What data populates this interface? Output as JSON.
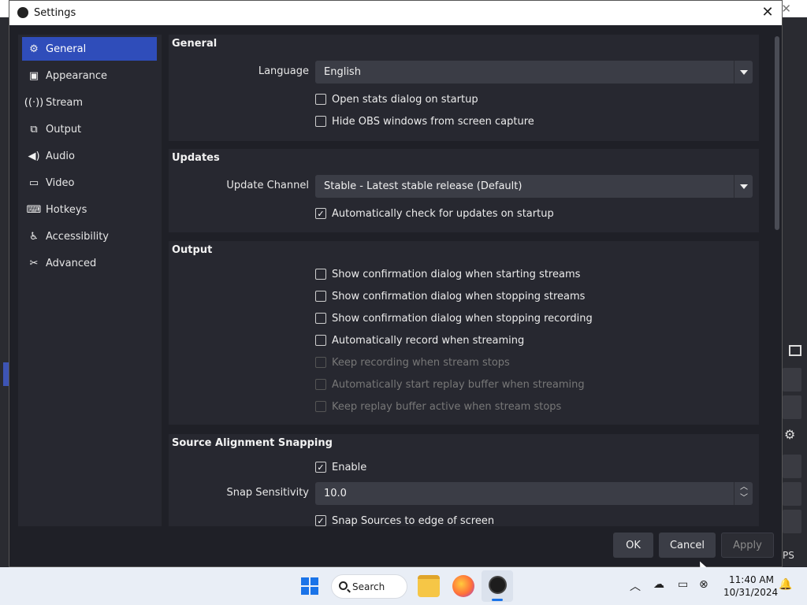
{
  "window": {
    "title": "Settings",
    "close_glyph": "✕"
  },
  "sidebar": {
    "items": [
      {
        "label": "General",
        "icon": "gear-icon",
        "active": true
      },
      {
        "label": "Appearance",
        "icon": "appearance-icon",
        "active": false
      },
      {
        "label": "Stream",
        "icon": "broadcast-icon",
        "active": false
      },
      {
        "label": "Output",
        "icon": "output-icon",
        "active": false
      },
      {
        "label": "Audio",
        "icon": "speaker-icon",
        "active": false
      },
      {
        "label": "Video",
        "icon": "monitor-icon",
        "active": false
      },
      {
        "label": "Hotkeys",
        "icon": "keyboard-icon",
        "active": false
      },
      {
        "label": "Accessibility",
        "icon": "accessibility-icon",
        "active": false
      },
      {
        "label": "Advanced",
        "icon": "tools-icon",
        "active": false
      }
    ]
  },
  "general": {
    "heading": "General",
    "language_label": "Language",
    "language_value": "English",
    "open_stats": {
      "label": "Open stats dialog on startup",
      "checked": false
    },
    "hide_obs": {
      "label": "Hide OBS windows from screen capture",
      "checked": false
    }
  },
  "updates": {
    "heading": "Updates",
    "channel_label": "Update Channel",
    "channel_value": "Stable - Latest stable release (Default)",
    "auto_check": {
      "label": "Automatically check for updates on startup",
      "checked": true
    }
  },
  "output": {
    "heading": "Output",
    "items": [
      {
        "label": "Show confirmation dialog when starting streams",
        "checked": false,
        "enabled": true
      },
      {
        "label": "Show confirmation dialog when stopping streams",
        "checked": false,
        "enabled": true
      },
      {
        "label": "Show confirmation dialog when stopping recording",
        "checked": false,
        "enabled": true
      },
      {
        "label": "Automatically record when streaming",
        "checked": false,
        "enabled": true
      },
      {
        "label": "Keep recording when stream stops",
        "checked": false,
        "enabled": false
      },
      {
        "label": "Automatically start replay buffer when streaming",
        "checked": false,
        "enabled": false
      },
      {
        "label": "Keep replay buffer active when stream stops",
        "checked": false,
        "enabled": false
      }
    ]
  },
  "snapping": {
    "heading": "Source Alignment Snapping",
    "enable": {
      "label": "Enable",
      "checked": true
    },
    "sensitivity_label": "Snap Sensitivity",
    "sensitivity_value": "10.0",
    "snap_edge": {
      "label": "Snap Sources to edge of screen",
      "checked": true
    }
  },
  "buttons": {
    "ok": "OK",
    "cancel": "Cancel",
    "apply": "Apply"
  },
  "background": {
    "fps_fragment": "PS"
  },
  "taskbar": {
    "search_label": "Search",
    "time": "11:40 AM",
    "date": "10/31/2024",
    "apps": [
      "windows-start-icon",
      "file-explorer-icon",
      "firefox-icon",
      "obs-icon"
    ],
    "tray_icons": [
      "chevron-up-icon",
      "onedrive-icon",
      "display-icon",
      "network-icon",
      "bell-icon"
    ]
  },
  "colors": {
    "accent": "#2f4dba",
    "dialog_bg": "#1f2027",
    "panel_bg": "#272830",
    "taskbar_bg": "#e9eef6"
  }
}
